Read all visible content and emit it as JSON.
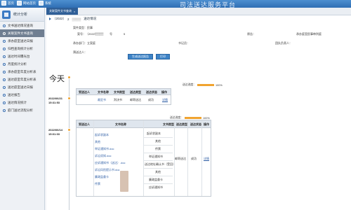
{
  "header": {
    "brand": "司法送达服务平台",
    "nav": [
      {
        "label": "首页"
      },
      {
        "label": "网站首页"
      },
      {
        "label": "系统"
      }
    ]
  },
  "sidebar": {
    "title": "统计分析",
    "items": [
      {
        "label": "文书送达情况查询"
      },
      {
        "label": "关联案件文书查询"
      },
      {
        "label": "承办庭室送达日报"
      },
      {
        "label": "归档查询统计分析"
      },
      {
        "label": "送达时间曝光台"
      },
      {
        "label": "月度统计分析"
      },
      {
        "label": "承办庭室年度分析表"
      },
      {
        "label": "送达庭室年度分析表"
      },
      {
        "label": "送达庭室送达日报"
      },
      {
        "label": "送达报告"
      },
      {
        "label": "送达情况统计"
      },
      {
        "label": "庭门送达流程分析"
      }
    ]
  },
  "tabs": [
    {
      "label": "关联案件文书查询"
    },
    {
      "label": "送达情况"
    }
  ],
  "subtitle": {
    "case_no": "（2022）",
    "case_no2": "2",
    "title": "送达情况"
  },
  "case_info": {
    "type_label": "案件类型：",
    "type_value": "民事",
    "number_label": "案号：（2022）",
    "number_suffix": "号",
    "plaintiff_label": "原告：",
    "court_label": "承办庭室：",
    "court_value": "民事审判庭",
    "dept_label": "承办部门：",
    "dept_value": "立案庭",
    "clerk_label": "书记员：",
    "judge_label": "预送达人："
  },
  "buttons": {
    "generate": "生成送达报告",
    "print": "打印"
  },
  "timeline": {
    "today": "今天",
    "progress_label": "送达进度：",
    "progress_value": "100%",
    "progress_fraction": 1.0,
    "entries": [
      {
        "date": "2022/06/21",
        "time": "15:31:53",
        "headers": [
          "受送达人",
          "文书名称",
          "文书类型",
          "送达类型",
          "送达状态",
          "操作"
        ],
        "rows": [
          {
            "recipient": "",
            "doc": "裁定书",
            "doc_type": "判决书",
            "send_type": "邮寄送达",
            "status": "成功",
            "op": "详情"
          }
        ]
      },
      {
        "date": "2022/06/14",
        "time": "15:01:03",
        "headers": [
          "受送达人",
          "文书名称",
          "文书类型",
          "送达类型",
          "送达状态",
          "操作"
        ],
        "docs": [
          "起诉状副本",
          "其他",
          "举证通知书.doc",
          "诉讼须知.doc",
          "应诉通知书（送达）.doc",
          "诉讼风险提示书.doc",
          "廉政监督卡",
          "传票"
        ],
        "types": [
          "起诉状副本",
          "其他",
          "传票",
          "举证通知书",
          "送达地址确认书（受回）",
          "其他",
          "廉政监督卡",
          "应诉通知书"
        ],
        "send_type": "邮寄送达",
        "status": "成功",
        "op": "详情"
      }
    ]
  },
  "colors": {
    "accent": "#3d6fab",
    "timeline": "#f0a330",
    "link": "#2f5fa6"
  }
}
